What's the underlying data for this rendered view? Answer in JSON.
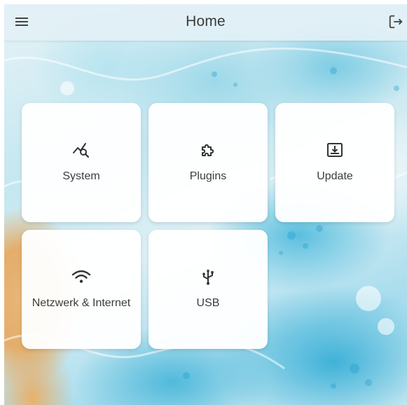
{
  "header": {
    "title": "Home",
    "menu_icon": "hamburger-menu-icon",
    "logout_icon": "logout-icon"
  },
  "tiles": [
    {
      "label": "System",
      "icon": "monitoring-search-icon"
    },
    {
      "label": "Plugins",
      "icon": "puzzle-piece-icon"
    },
    {
      "label": "Update",
      "icon": "download-tray-icon"
    },
    {
      "label": "Netzwerk & Internet",
      "icon": "wifi-icon"
    },
    {
      "label": "USB",
      "icon": "usb-icon"
    }
  ],
  "colors": {
    "tile_background": "#ffffff",
    "text": "#3c3c3c",
    "header_background": "#e2f0f6"
  }
}
